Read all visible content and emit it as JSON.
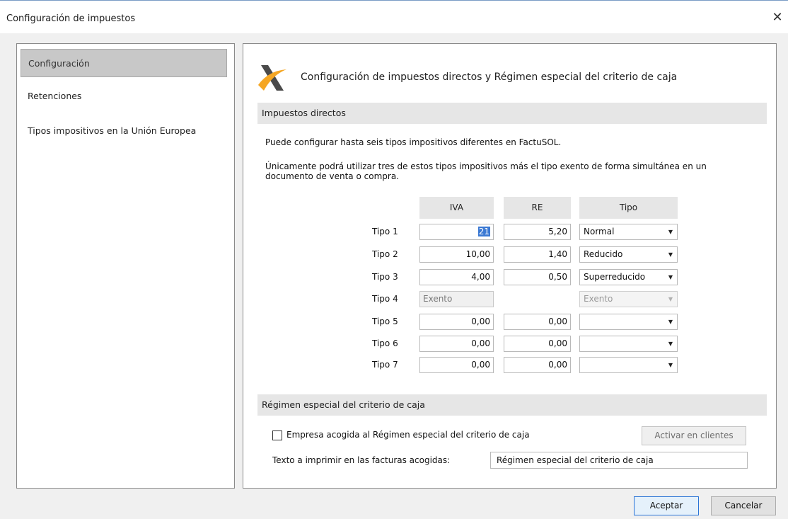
{
  "window": {
    "title": "Configuración de impuestos",
    "close_symbol": "✕"
  },
  "sidebar": {
    "items": [
      {
        "label": "Configuración",
        "active": true
      },
      {
        "label": "Retenciones",
        "active": false
      },
      {
        "label": "Tipos impositivos en la Unión Europea",
        "active": false
      }
    ]
  },
  "main": {
    "title": "Configuración de impuestos directos y Régimen especial del criterio de caja",
    "logo_icon": "tax-agency-logo-icon",
    "direct": {
      "heading": "Impuestos directos",
      "para1": "Puede configurar hasta seis tipos impositivos diferentes en FactuSOL.",
      "para2": "Únicamente podrá utilizar tres de estos tipos impositivos más el tipo exento de forma simultánea en un documento de venta o compra.",
      "columns": {
        "iva": "IVA",
        "re": "RE",
        "tipo": "Tipo"
      },
      "rows": [
        {
          "label": "Tipo 1",
          "iva": "21",
          "re": "5,20",
          "tipo": "Normal"
        },
        {
          "label": "Tipo 2",
          "iva": "10,00",
          "re": "1,40",
          "tipo": "Reducido"
        },
        {
          "label": "Tipo 3",
          "iva": "4,00",
          "re": "0,50",
          "tipo": "Superreducido"
        },
        {
          "label": "Tipo 4",
          "iva": "Exento",
          "re": "",
          "tipo": "Exento"
        },
        {
          "label": "Tipo 5",
          "iva": "0,00",
          "re": "0,00",
          "tipo": ""
        },
        {
          "label": "Tipo 6",
          "iva": "0,00",
          "re": "0,00",
          "tipo": ""
        },
        {
          "label": "Tipo 7",
          "iva": "0,00",
          "re": "0,00",
          "tipo": ""
        }
      ]
    },
    "cash": {
      "heading": "Régimen especial del criterio de caja",
      "checkbox_label": "Empresa acogida al Régimen especial del criterio de caja",
      "activate_button": "Activar en clientes",
      "text_label": "Texto a imprimir en las facturas acogidas:",
      "text_value": "Régimen especial del criterio de caja"
    }
  },
  "footer": {
    "accept": "Aceptar",
    "cancel": "Cancelar"
  },
  "colors": {
    "selection": "#3b79d3",
    "section_bg": "#e6e6e6",
    "logo_orange": "#f5a623",
    "logo_dark": "#4a4a4a"
  }
}
